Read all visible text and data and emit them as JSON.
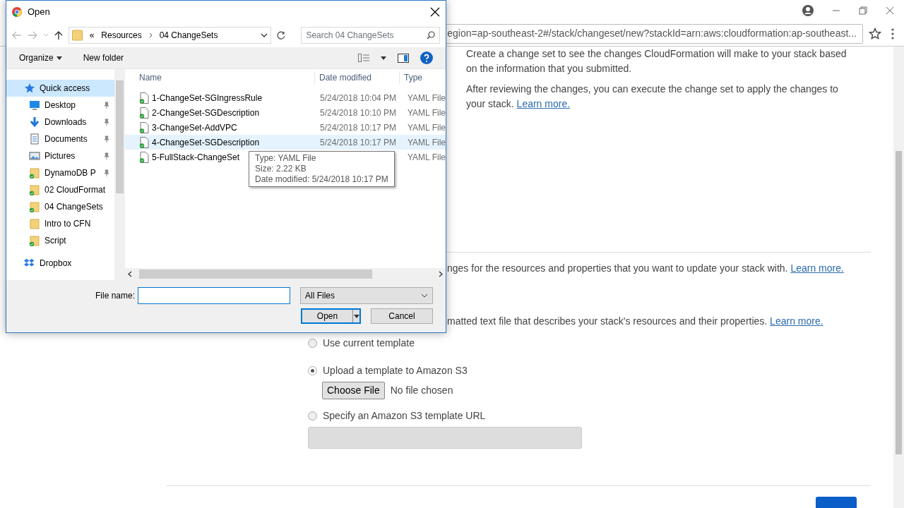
{
  "browser": {
    "url": "egion=ap-southeast-2#/stack/changeset/new?stackId=arn:aws:cloudformation:ap-southeast..."
  },
  "page": {
    "intro": [
      {
        "text": "Create a change set to see the changes CloudFormation will make to your stack based on the information that you submitted."
      },
      {
        "text": "After reviewing the changes, you can execute the change set to apply the changes to your stack.",
        "link": "Learn more."
      }
    ],
    "changes_note": {
      "text": "nges for the resources and properties that you want to update your stack with.",
      "link": "Learn more."
    },
    "template_note": {
      "text": "matted text file that describes your stack's resources and their properties.",
      "link": "Learn more."
    },
    "template_options": [
      {
        "label": "Use current template",
        "selected": false
      },
      {
        "label": "Upload a template to Amazon S3",
        "selected": true
      },
      {
        "label": "Specify an Amazon S3 template URL",
        "selected": false
      }
    ],
    "choose_file": {
      "button": "Choose File",
      "status": "No file chosen"
    }
  },
  "dialog": {
    "title": "Open",
    "breadcrumb": [
      "«",
      "Resources",
      "04 ChangeSets"
    ],
    "search": {
      "placeholder": "Search 04 ChangeSets"
    },
    "toolbar": [
      "Organize",
      "New folder"
    ],
    "nav": [
      {
        "label": "Quick access",
        "kind": "star",
        "selected": true,
        "pinned": false,
        "synced": false
      },
      {
        "label": "Desktop",
        "kind": "desktop",
        "selected": false,
        "pinned": true,
        "synced": false
      },
      {
        "label": "Downloads",
        "kind": "download",
        "selected": false,
        "pinned": true,
        "synced": false
      },
      {
        "label": "Documents",
        "kind": "documents",
        "selected": false,
        "pinned": true,
        "synced": false
      },
      {
        "label": "Pictures",
        "kind": "pictures",
        "selected": false,
        "pinned": true,
        "synced": false
      },
      {
        "label": "DynamoDB P",
        "kind": "folder",
        "selected": false,
        "pinned": true,
        "synced": true
      },
      {
        "label": "02 CloudFormat",
        "kind": "folder",
        "selected": false,
        "pinned": false,
        "synced": true
      },
      {
        "label": "04 ChangeSets",
        "kind": "folder",
        "selected": false,
        "pinned": false,
        "synced": true
      },
      {
        "label": "Intro to CFN",
        "kind": "folder",
        "selected": false,
        "pinned": false,
        "synced": false
      },
      {
        "label": "Script",
        "kind": "folder",
        "selected": false,
        "pinned": false,
        "synced": true
      },
      {
        "label": "Dropbox",
        "kind": "dropbox",
        "selected": false,
        "pinned": false,
        "synced": false
      }
    ],
    "columns": [
      "Name",
      "Date modified",
      "Type"
    ],
    "files": [
      {
        "name": "1-ChangeSet-SGIngressRule",
        "date": "5/24/2018 10:04 PM",
        "type": "YAML File",
        "selected": false
      },
      {
        "name": "2-ChangeSet-SGDescription",
        "date": "5/24/2018 10:10 PM",
        "type": "YAML File",
        "selected": false
      },
      {
        "name": "3-ChangeSet-AddVPC",
        "date": "5/24/2018 10:17 PM",
        "type": "YAML File",
        "selected": false
      },
      {
        "name": "4-ChangeSet-SGDescription",
        "date": "5/24/2018 10:17 PM",
        "type": "YAML File",
        "selected": true
      },
      {
        "name": "5-FullStack-ChangeSet",
        "type": "YAML File",
        "selected": false
      }
    ],
    "tooltip": [
      "Type: YAML File",
      "Size: 2.22 KB",
      "Date modified: 5/24/2018 10:17 PM"
    ],
    "file_name": {
      "label": "File name:"
    },
    "filter": "All Files",
    "buttons": [
      "Open",
      "Cancel"
    ]
  }
}
